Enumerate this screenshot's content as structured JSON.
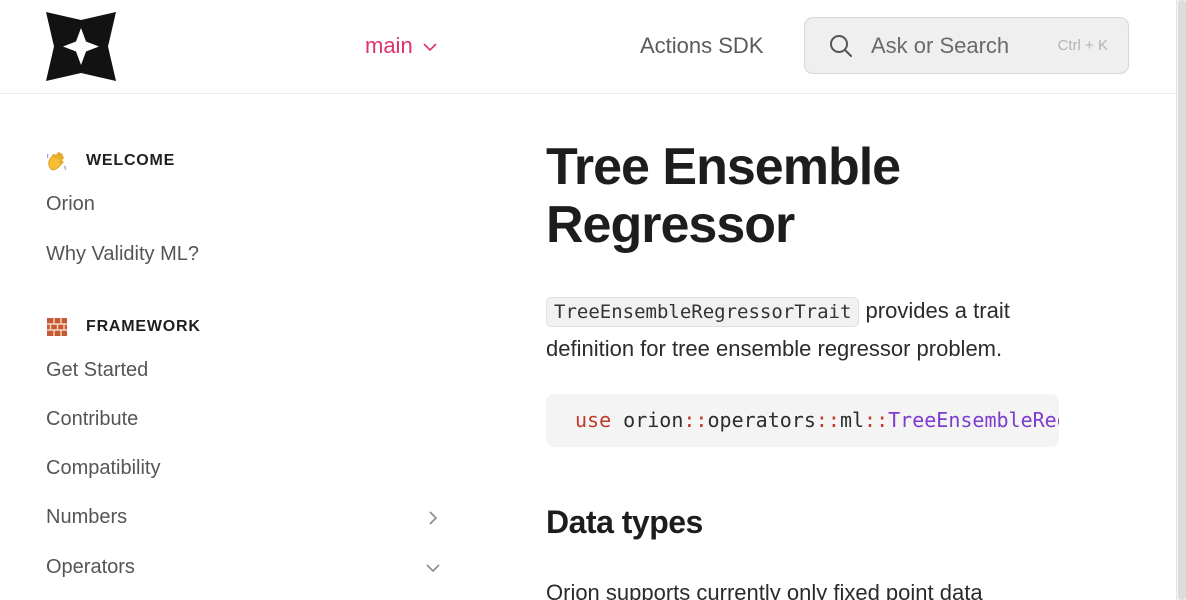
{
  "header": {
    "logo_icon": "orion-star-logo-icon",
    "branch_label": "main",
    "nav_link": "Actions SDK",
    "search": {
      "placeholder": "Ask or Search",
      "shortcut": "Ctrl + K",
      "icon": "search-icon"
    }
  },
  "sidebar": {
    "sections": [
      {
        "emoji": "waving-hand-icon",
        "title": "WELCOME",
        "items": [
          {
            "label": "Orion"
          },
          {
            "label": "Why Validity ML?"
          }
        ]
      },
      {
        "emoji": "brick-icon",
        "title": "FRAMEWORK",
        "items": [
          {
            "label": "Get Started"
          },
          {
            "label": "Contribute"
          },
          {
            "label": "Compatibility"
          },
          {
            "label": "Numbers",
            "chevron": "chevron-right-icon"
          },
          {
            "label": "Operators",
            "chevron": "chevron-down-icon"
          }
        ]
      }
    ]
  },
  "main": {
    "title": "Tree Ensemble Regressor",
    "intro_code": "TreeEnsembleRegressorTrait",
    "intro_text": " provides a trait definition for tree ensemble regressor problem.",
    "code": {
      "keyword": "use",
      "path1": "orion",
      "sep": "::",
      "path2": "operators",
      "path3": "ml",
      "type": "TreeEnsembleRegressorTrait"
    },
    "section_title": "Data types",
    "section_text": "Orion supports currently only fixed point data"
  },
  "colors": {
    "accent": "#e0336e",
    "keyword": "#c0392b",
    "type": "#7d3ccf"
  }
}
